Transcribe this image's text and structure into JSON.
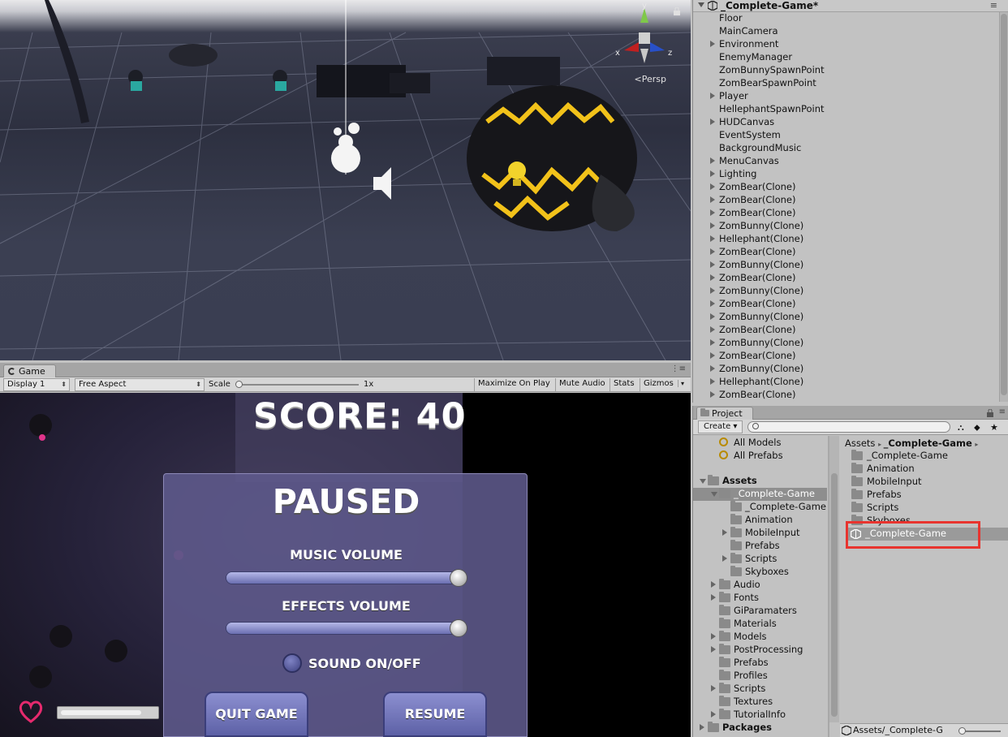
{
  "scene": {
    "persp_label": "<Persp",
    "gizmo_axes": {
      "x": "x",
      "y": "y",
      "z": "z"
    }
  },
  "game": {
    "tab_label": "Game",
    "toolbar": {
      "display": "Display 1",
      "aspect": "Free Aspect",
      "scale_label": "Scale",
      "scale_value": "1x",
      "buttons": [
        "Maximize On Play",
        "Mute Audio",
        "Stats",
        "Gizmos"
      ]
    },
    "score": "SCORE: 40",
    "pause_menu": {
      "title": "PAUSED",
      "music_label": "MUSIC VOLUME",
      "music_level": 0.97,
      "effects_label": "EFFECTS VOLUME",
      "effects_level": 0.97,
      "sound_label": "SOUND ON/OFF",
      "quit_label": "QUIT GAME",
      "resume_label": "RESUME"
    },
    "health_level": 0.85
  },
  "hierarchy": {
    "scene_name": "_Complete-Game*",
    "items": [
      {
        "name": "Floor",
        "expandable": false
      },
      {
        "name": "MainCamera",
        "expandable": false
      },
      {
        "name": "Environment",
        "expandable": true
      },
      {
        "name": "EnemyManager",
        "expandable": false
      },
      {
        "name": "ZomBunnySpawnPoint",
        "expandable": false
      },
      {
        "name": "ZomBearSpawnPoint",
        "expandable": false
      },
      {
        "name": "Player",
        "expandable": true
      },
      {
        "name": "HellephantSpawnPoint",
        "expandable": false
      },
      {
        "name": "HUDCanvas",
        "expandable": true
      },
      {
        "name": "EventSystem",
        "expandable": false
      },
      {
        "name": "BackgroundMusic",
        "expandable": false
      },
      {
        "name": "MenuCanvas",
        "expandable": true
      },
      {
        "name": "Lighting",
        "expandable": true
      },
      {
        "name": "ZomBear(Clone)",
        "expandable": true
      },
      {
        "name": "ZomBear(Clone)",
        "expandable": true
      },
      {
        "name": "ZomBear(Clone)",
        "expandable": true
      },
      {
        "name": "ZomBunny(Clone)",
        "expandable": true
      },
      {
        "name": "Hellephant(Clone)",
        "expandable": true
      },
      {
        "name": "ZomBear(Clone)",
        "expandable": true
      },
      {
        "name": "ZomBunny(Clone)",
        "expandable": true
      },
      {
        "name": "ZomBear(Clone)",
        "expandable": true
      },
      {
        "name": "ZomBunny(Clone)",
        "expandable": true
      },
      {
        "name": "ZomBear(Clone)",
        "expandable": true
      },
      {
        "name": "ZomBunny(Clone)",
        "expandable": true
      },
      {
        "name": "ZomBear(Clone)",
        "expandable": true
      },
      {
        "name": "ZomBunny(Clone)",
        "expandable": true
      },
      {
        "name": "ZomBear(Clone)",
        "expandable": true
      },
      {
        "name": "ZomBunny(Clone)",
        "expandable": true
      },
      {
        "name": "Hellephant(Clone)",
        "expandable": true
      },
      {
        "name": "ZomBear(Clone)",
        "expandable": true
      }
    ]
  },
  "project": {
    "tab_label": "Project",
    "create_label": "Create",
    "favorites": [
      "All Models",
      "All Prefabs"
    ],
    "tree": [
      {
        "name": "Assets",
        "bold": true,
        "expander": "open"
      },
      {
        "name": "_Complete-Game",
        "expander": "open",
        "selected": true
      },
      {
        "name": "_Complete-Game",
        "expander": "none"
      },
      {
        "name": "Animation",
        "expander": "none"
      },
      {
        "name": "MobileInput",
        "expander": "closed"
      },
      {
        "name": "Prefabs",
        "expander": "none"
      },
      {
        "name": "Scripts",
        "expander": "closed"
      },
      {
        "name": "Skyboxes",
        "expander": "none"
      },
      {
        "name": "Audio",
        "expander": "closed"
      },
      {
        "name": "Fonts",
        "expander": "closed"
      },
      {
        "name": "GiParamaters",
        "expander": "none"
      },
      {
        "name": "Materials",
        "expander": "none"
      },
      {
        "name": "Models",
        "expander": "closed"
      },
      {
        "name": "PostProcessing",
        "expander": "closed"
      },
      {
        "name": "Prefabs",
        "expander": "none"
      },
      {
        "name": "Profiles",
        "expander": "none"
      },
      {
        "name": "Scripts",
        "expander": "closed"
      },
      {
        "name": "Textures",
        "expander": "none"
      },
      {
        "name": "TutorialInfo",
        "expander": "closed"
      },
      {
        "name": "Packages",
        "bold": true,
        "expander": "closed"
      }
    ],
    "breadcrumb": {
      "root": "Assets",
      "current": "_Complete-Game"
    },
    "folder_items": [
      "_Complete-Game",
      "Animation",
      "MobileInput",
      "Prefabs",
      "Scripts",
      "Skyboxes"
    ],
    "scene_item": "_Complete-Game",
    "footer_path": "Assets/_Complete-G"
  }
}
